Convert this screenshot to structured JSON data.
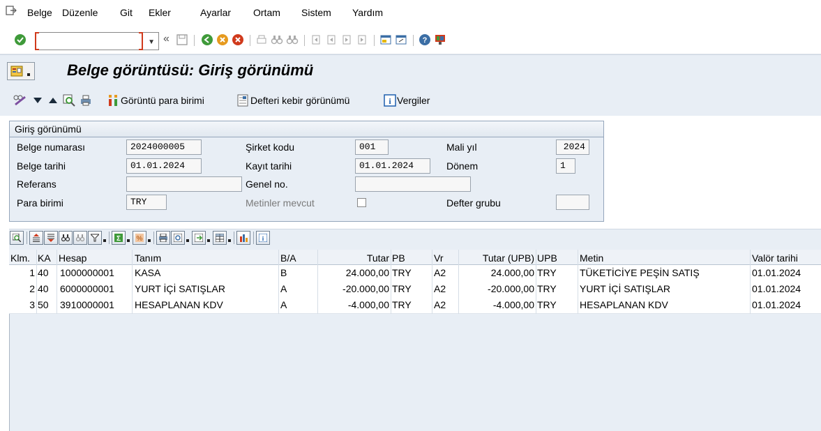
{
  "menu": {
    "items": [
      "Belge",
      "Düzenle",
      "Git",
      "Ekler",
      "Ayarlar",
      "Ortam",
      "Sistem",
      "Yardım"
    ]
  },
  "system_toolbar": {
    "command_field_value": "",
    "back_label": "«"
  },
  "title": "Belge görüntüsü: Giriş görünümü",
  "app_toolbar": {
    "display_currency": "Görüntü para birimi",
    "ledger_view": "Defteri kebir görünümü",
    "taxes": "Vergiler"
  },
  "header": {
    "group_title": "Giriş görünümü",
    "fields": {
      "belge_numarasi": {
        "label": "Belge numarası",
        "value": "2024000005"
      },
      "belge_tarihi": {
        "label": "Belge tarihi",
        "value": "01.01.2024"
      },
      "referans": {
        "label": "Referans",
        "value": ""
      },
      "para_birimi": {
        "label": "Para birimi",
        "value": "TRY"
      },
      "sirket_kodu": {
        "label": "Şirket kodu",
        "value": "001"
      },
      "kayit_tarihi": {
        "label": "Kayıt tarihi",
        "value": "01.01.2024"
      },
      "genel_no": {
        "label": "Genel no.",
        "value": ""
      },
      "metinler_mevcut": {
        "label": "Metinler mevcut",
        "checked": false
      },
      "mali_yil": {
        "label": "Mali yıl",
        "value": "2024"
      },
      "donem": {
        "label": "Dönem",
        "value": "1"
      },
      "defter_grubu": {
        "label": "Defter grubu",
        "value": ""
      }
    }
  },
  "grid": {
    "columns": [
      "Klm.",
      "KA",
      "Hesap",
      "Tanım",
      "B/A",
      "Tutar",
      "PB",
      "Vr",
      "Tutar (UPB)",
      "UPB",
      "Metin",
      "Valör tarihi"
    ],
    "rows": [
      {
        "klm": "1",
        "ka": "40",
        "hesap": "1000000001",
        "tanim": "KASA",
        "ba": "B",
        "tutar": "24.000,00",
        "pb": "TRY",
        "vr": "A2",
        "tutar_upb": "24.000,00",
        "upb": "TRY",
        "metin": "TÜKETİCİYE PEŞİN SATIŞ",
        "valor": "01.01.2024"
      },
      {
        "klm": "2",
        "ka": "40",
        "hesap": "6000000001",
        "tanim": "YURT İÇİ SATIŞLAR",
        "ba": "A",
        "tutar": "-20.000,00",
        "pb": "TRY",
        "vr": "A2",
        "tutar_upb": "-20.000,00",
        "upb": "TRY",
        "metin": "YURT İÇİ SATIŞLAR",
        "valor": "01.01.2024"
      },
      {
        "klm": "3",
        "ka": "50",
        "hesap": "3910000001",
        "tanim": "HESAPLANAN KDV",
        "ba": "A",
        "tutar": "-4.000,00",
        "pb": "TRY",
        "vr": "A2",
        "tutar_upb": "-4.000,00",
        "upb": "TRY",
        "metin": "HESAPLANAN KDV",
        "valor": "01.01.2024"
      }
    ]
  },
  "colors": {
    "background_panel": "#e8eef5",
    "accent_red": "#d03a1c",
    "green_ok": "#3f9a3a",
    "orange": "#e69a1f"
  }
}
